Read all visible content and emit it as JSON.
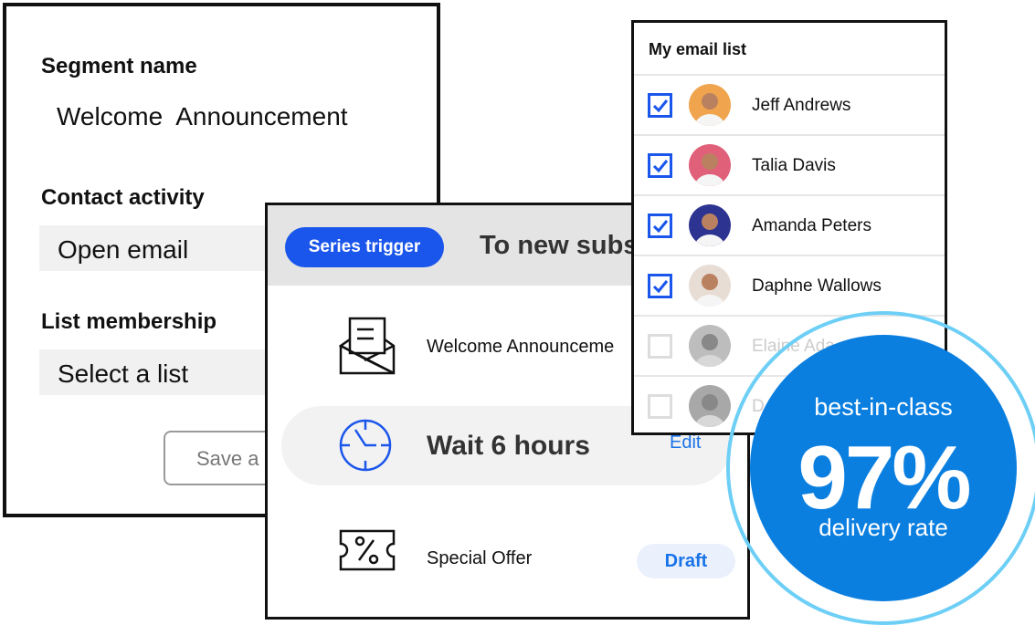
{
  "segment": {
    "name_label": "Segment name",
    "name_value": "Welcome  Announcement",
    "activity_label": "Contact activity",
    "activity_value": "Open email",
    "list_label": "List membership",
    "list_placeholder": "Select a list",
    "save_label": "Save a"
  },
  "series": {
    "trigger_label": "Series trigger",
    "trigger_target": "To new subs",
    "steps": [
      {
        "icon": "envelope-open-icon",
        "label": "Welcome Announceme"
      },
      {
        "icon": "clock-icon",
        "label": "Wait 6 hours",
        "action": "Edit"
      },
      {
        "icon": "coupon-percent-icon",
        "label": "Special Offer",
        "status": "Draft"
      }
    ]
  },
  "email_list": {
    "title": "My email list",
    "contacts": [
      {
        "name": "Jeff Andrews",
        "checked": true,
        "avatar_color": "#f0a44e"
      },
      {
        "name": "Talia Davis",
        "checked": true,
        "avatar_color": "#e0607a"
      },
      {
        "name": "Amanda Peters",
        "checked": true,
        "avatar_color": "#2c3390"
      },
      {
        "name": "Daphne Wallows",
        "checked": true,
        "avatar_color": "#e8ddd4"
      },
      {
        "name": "Elaine Ada",
        "checked": false,
        "avatar_color": "#bdbdbd"
      },
      {
        "name": "D",
        "checked": false,
        "avatar_color": "#a8a8a8"
      }
    ]
  },
  "badge": {
    "top": "best-in-class",
    "value": "97%",
    "bottom": "delivery rate"
  },
  "colors": {
    "primary": "#1a56eb",
    "link": "#1a73e8",
    "badge": "#0a7fe0",
    "ring": "#6dcff6"
  }
}
